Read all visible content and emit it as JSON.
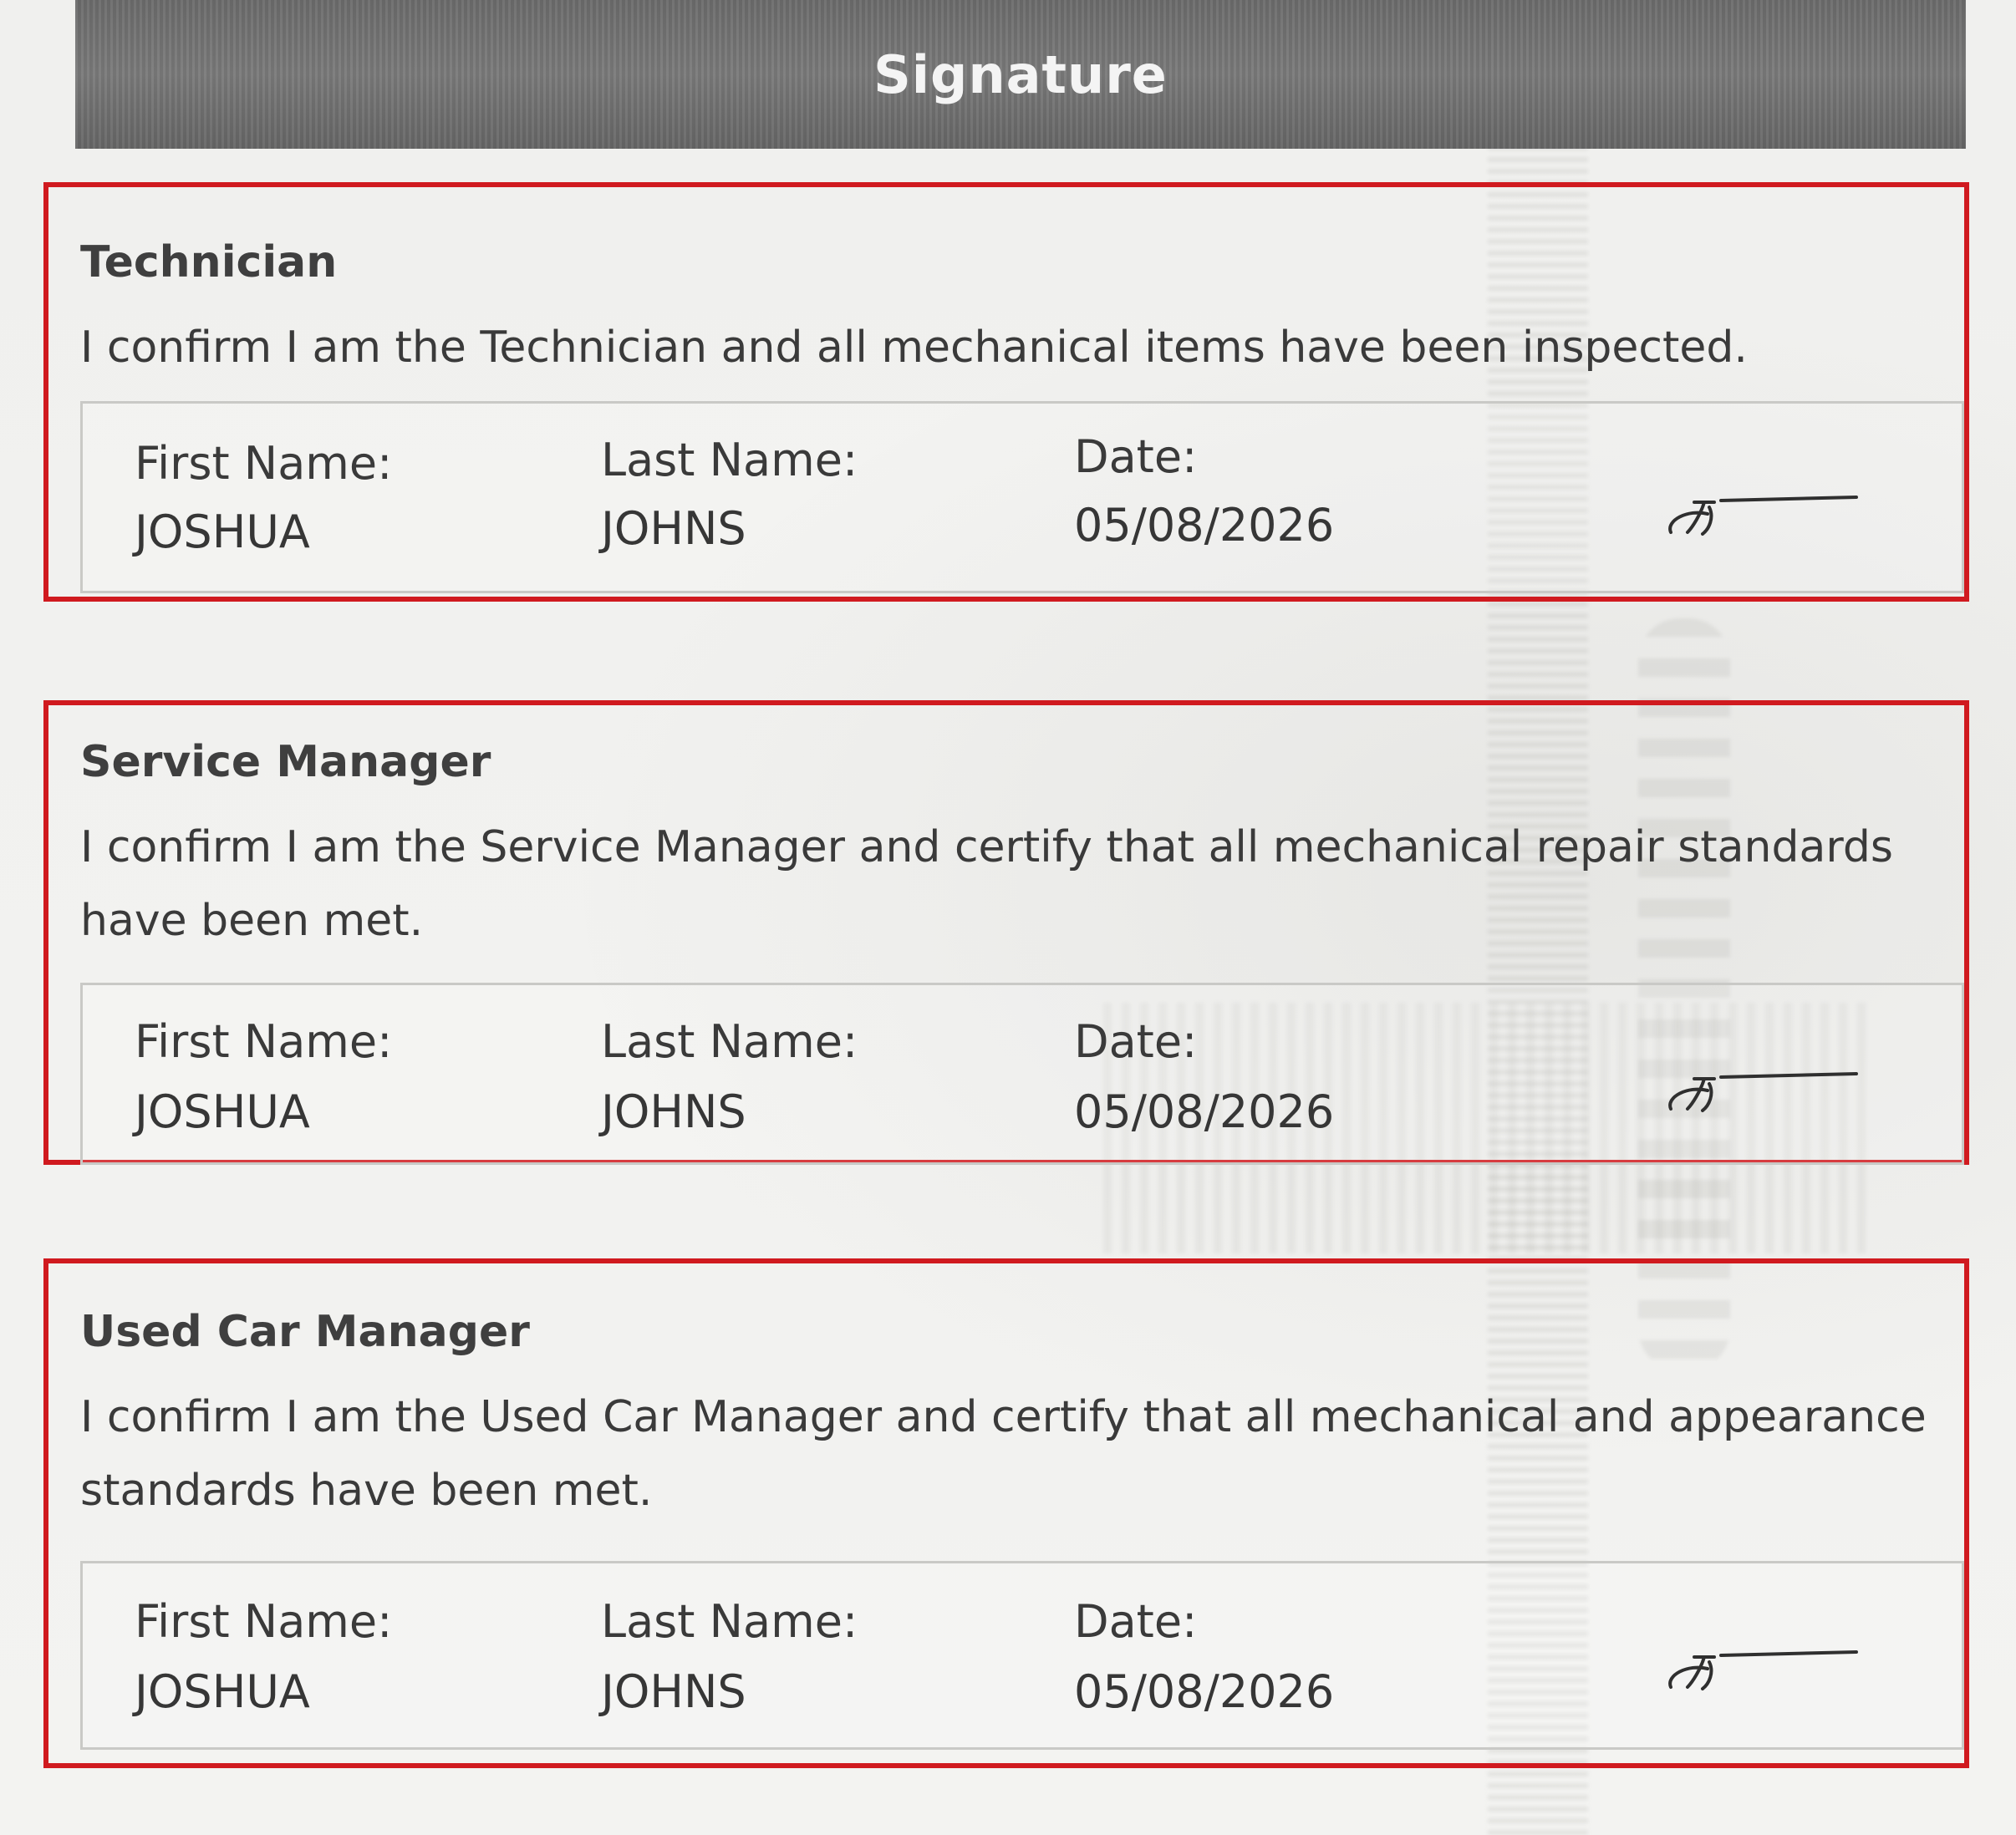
{
  "header": {
    "title": "Signature"
  },
  "labels": {
    "first_name": "First Name:",
    "last_name": "Last Name:",
    "date": "Date:"
  },
  "sections": [
    {
      "role": "Technician",
      "statement": "I confirm I am the Technician and all mechanical items have been inspected.",
      "first_name": "JOSHUA",
      "last_name": "JOHNS",
      "date": "05/08/2026",
      "signature_icon": "handwritten-signature-icon"
    },
    {
      "role": "Service Manager",
      "statement": "I confirm I am the Service Manager and certify that all mechanical repair standards have been met.",
      "first_name": "JOSHUA",
      "last_name": "JOHNS",
      "date": "05/08/2026",
      "signature_icon": "handwritten-signature-icon"
    },
    {
      "role": "Used Car Manager",
      "statement": "I confirm I am the Used Car Manager and certify that all mechanical and appearance standards have been met.",
      "first_name": "JOSHUA",
      "last_name": "JOHNS",
      "date": "05/08/2026",
      "signature_icon": "handwritten-signature-icon"
    }
  ],
  "colors": {
    "highlight_border": "#d01a1f",
    "header_bg": "#6f6f6f",
    "header_text": "#f4f4f4",
    "text": "#3a3a3a"
  }
}
